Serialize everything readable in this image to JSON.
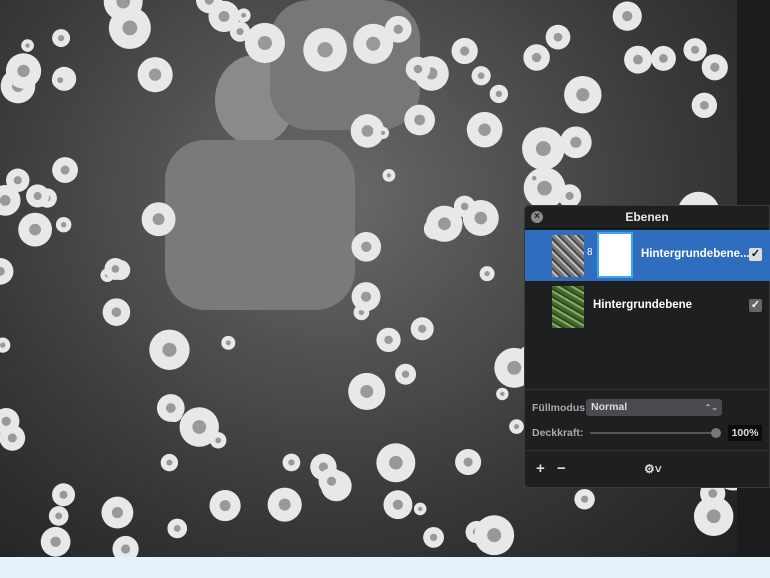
{
  "panel": {
    "title": "Ebenen",
    "close_icon": "close-icon",
    "layers": [
      {
        "name": "Hintergrundebene...",
        "visible": true,
        "selected": true,
        "has_mask": true
      },
      {
        "name": "Hintergrundebene",
        "visible": true,
        "selected": false,
        "has_mask": false
      }
    ],
    "blend_label": "Füllmodus:",
    "blend_value": "Normal",
    "opacity_label": "Deckkraft:",
    "opacity_value": "100%",
    "opacity_fraction": 1.0,
    "add_label": "+",
    "remove_label": "−",
    "settings_label": "⚙˅"
  },
  "colors": {
    "selection": "#2f6dbe",
    "panel_bg": "#1e1f21"
  }
}
